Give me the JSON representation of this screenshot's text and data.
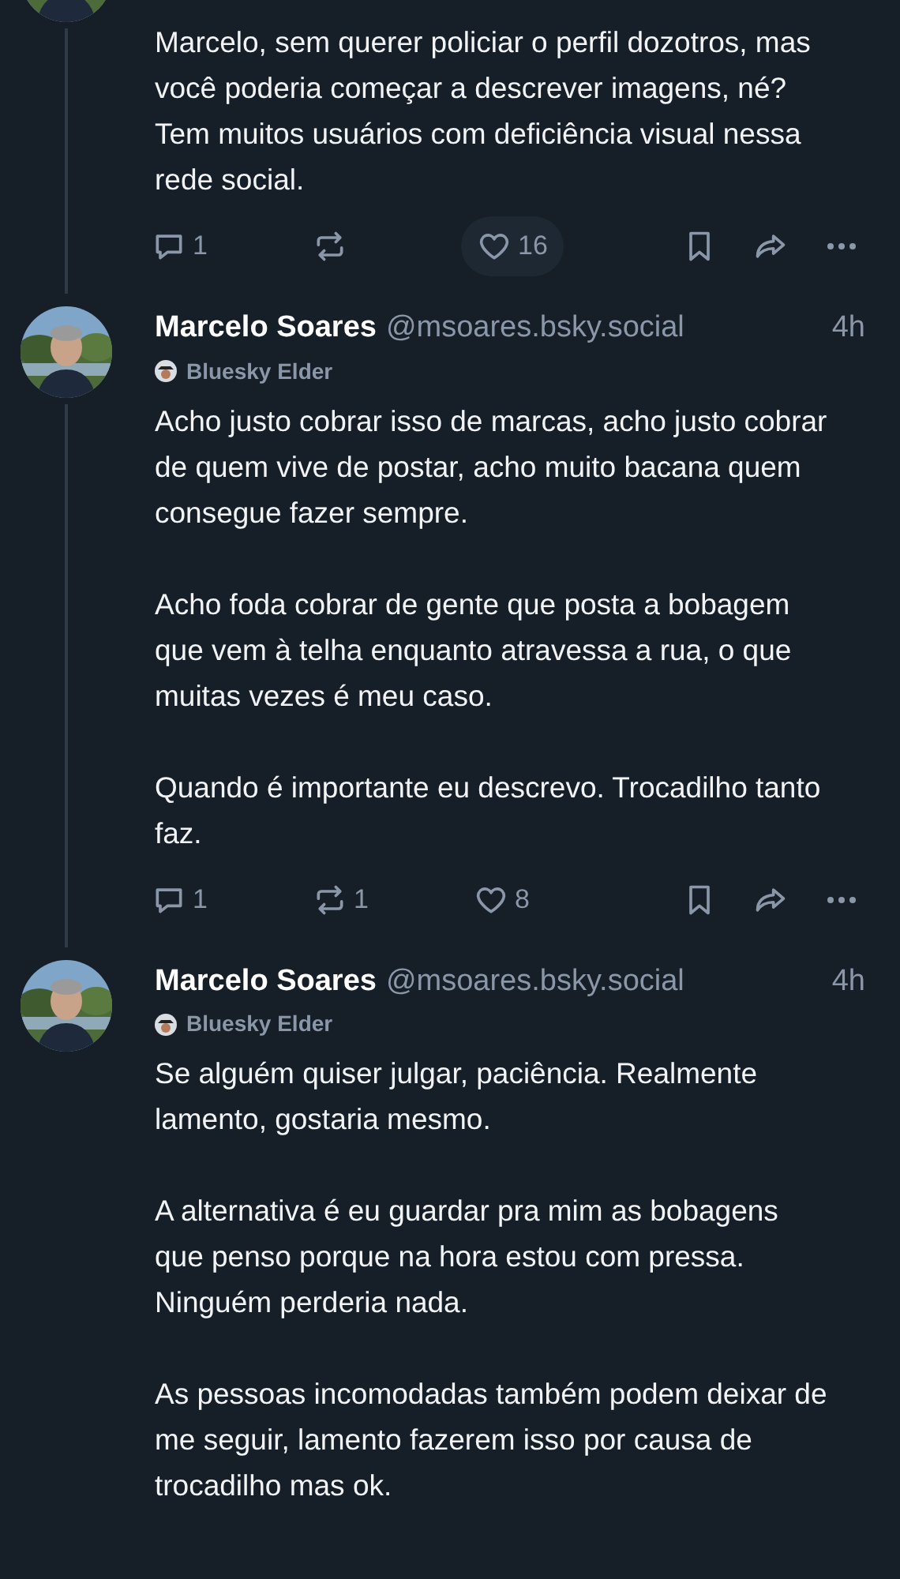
{
  "posts": [
    {
      "paragraphs": [
        "Marcelo, sem querer policiar o perfil dozotros, mas você poderia começar a descrever imagens, né? Tem muitos usuários com deficiência visual nessa rede social."
      ],
      "thread_line": true,
      "actions": [
        {
          "kind": "reply",
          "count": "1",
          "highlighted": false
        },
        {
          "kind": "repost",
          "highlighted": false
        },
        {
          "kind": "like",
          "count": "16",
          "highlighted": true
        },
        {
          "kind": "bookmark",
          "highlighted": false
        },
        {
          "kind": "share",
          "highlighted": false
        },
        {
          "kind": "more",
          "highlighted": false
        }
      ]
    },
    {
      "author": "Marcelo Soares",
      "handle": "@msoares.bsky.social",
      "time": "4h",
      "badge": "Bluesky Elder",
      "paragraphs": [
        "Acho justo cobrar isso de marcas, acho justo cobrar de quem vive de postar, acho muito bacana quem consegue fazer sempre.",
        "Acho foda cobrar de gente que posta a bobagem que vem à telha enquanto atravessa a rua, o que muitas vezes é meu caso.",
        "Quando é importante eu descrevo. Trocadilho tanto faz."
      ],
      "thread_line": true,
      "actions": [
        {
          "kind": "reply",
          "count": "1",
          "highlighted": false
        },
        {
          "kind": "repost",
          "count": "1",
          "highlighted": false
        },
        {
          "kind": "like",
          "count": "8",
          "highlighted": false
        },
        {
          "kind": "bookmark",
          "highlighted": false
        },
        {
          "kind": "share",
          "highlighted": false
        },
        {
          "kind": "more",
          "highlighted": false
        }
      ]
    },
    {
      "author": "Marcelo Soares",
      "handle": "@msoares.bsky.social",
      "time": "4h",
      "badge": "Bluesky Elder",
      "paragraphs": [
        "Se alguém quiser julgar, paciência. Realmente lamento, gostaria mesmo.",
        "A alternativa é eu guardar pra mim as bobagens que penso porque na hora estou com pressa.  Ninguém perderia nada.",
        "As pessoas incomodadas também podem deixar de me seguir, lamento fazerem isso por causa de trocadilho mas ok."
      ],
      "thread_line": false
    }
  ]
}
